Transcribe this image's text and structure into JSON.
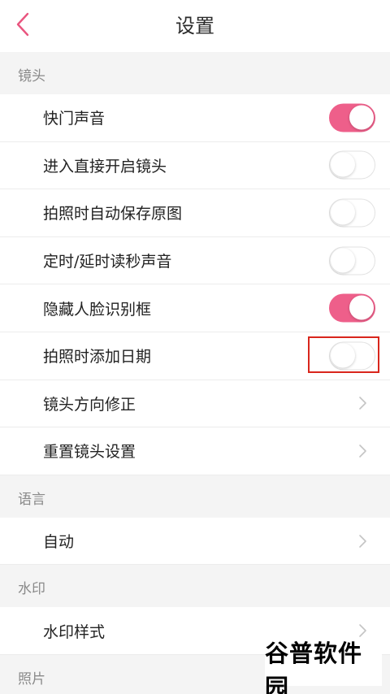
{
  "header": {
    "title": "设置"
  },
  "sections": {
    "camera": {
      "label": "镜头",
      "items": [
        {
          "label": "快门声音",
          "type": "toggle",
          "on": true
        },
        {
          "label": "进入直接开启镜头",
          "type": "toggle",
          "on": false
        },
        {
          "label": "拍照时自动保存原图",
          "type": "toggle",
          "on": false
        },
        {
          "label": "定时/延时读秒声音",
          "type": "toggle",
          "on": false
        },
        {
          "label": "隐藏人脸识别框",
          "type": "toggle",
          "on": true
        },
        {
          "label": "拍照时添加日期",
          "type": "toggle",
          "on": false
        },
        {
          "label": "镜头方向修正",
          "type": "link"
        },
        {
          "label": "重置镜头设置",
          "type": "link"
        }
      ]
    },
    "language": {
      "label": "语言",
      "items": [
        {
          "label": "自动",
          "type": "link"
        }
      ]
    },
    "watermark": {
      "label": "水印",
      "items": [
        {
          "label": "水印样式",
          "type": "link"
        }
      ]
    },
    "photo": {
      "label": "照片"
    }
  },
  "overlay": {
    "logo_text": "谷普软件园"
  },
  "colors": {
    "accent": "#ee5f8a",
    "highlight": "#d9261c",
    "back_arrow": "#e9557f"
  }
}
